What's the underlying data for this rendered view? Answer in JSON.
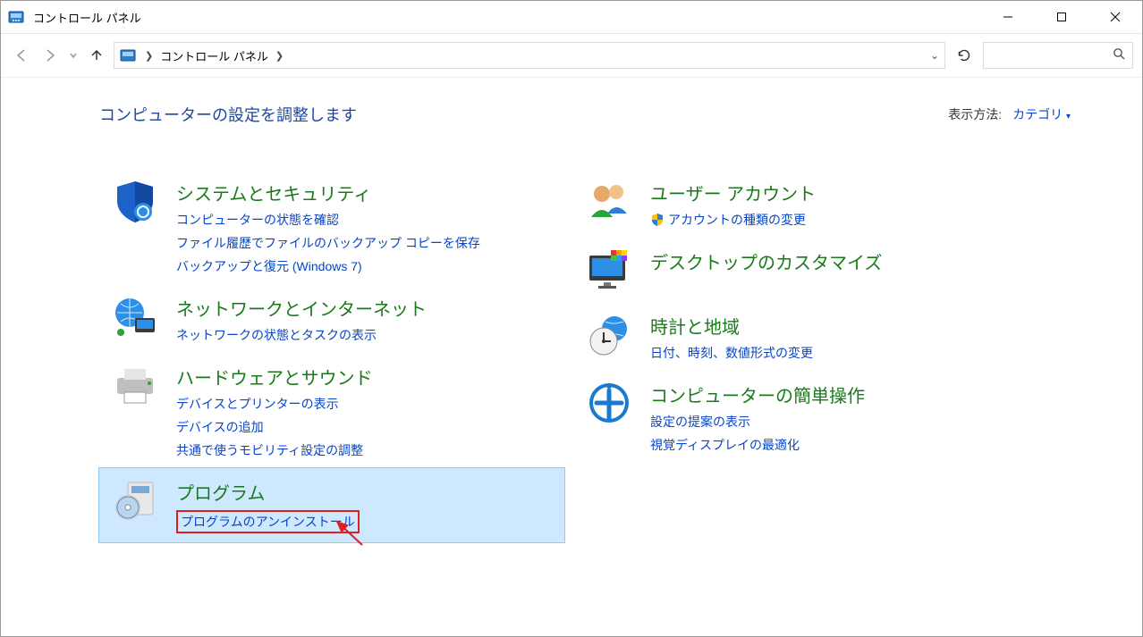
{
  "titlebar": {
    "title": "コントロール パネル"
  },
  "nav": {
    "breadcrumb": "コントロール パネル"
  },
  "page": {
    "title": "コンピューターの設定を調整します",
    "view_label": "表示方法:",
    "view_value": "カテゴリ"
  },
  "categories": {
    "left": [
      {
        "id": "system-security",
        "head": "システムとセキュリティ",
        "subs": [
          {
            "id": "system-status",
            "text": "コンピューターの状態を確認"
          },
          {
            "id": "file-history",
            "text": "ファイル履歴でファイルのバックアップ コピーを保存"
          },
          {
            "id": "backup-restore",
            "text": "バックアップと復元 (Windows 7)"
          }
        ]
      },
      {
        "id": "network",
        "head": "ネットワークとインターネット",
        "subs": [
          {
            "id": "net-status",
            "text": "ネットワークの状態とタスクの表示"
          }
        ]
      },
      {
        "id": "hardware-sound",
        "head": "ハードウェアとサウンド",
        "subs": [
          {
            "id": "devices-printers",
            "text": "デバイスとプリンターの表示"
          },
          {
            "id": "add-device",
            "text": "デバイスの追加"
          },
          {
            "id": "mobility",
            "text": "共通で使うモビリティ設定の調整"
          }
        ]
      },
      {
        "id": "programs",
        "head": "プログラム",
        "highlight": true,
        "subs": [
          {
            "id": "uninstall",
            "text": "プログラムのアンインストール",
            "boxed": true
          }
        ]
      }
    ],
    "right": [
      {
        "id": "user-accounts",
        "head": "ユーザー アカウント",
        "subs": [
          {
            "id": "change-account-type",
            "text": "アカウントの種類の変更",
            "shield": true
          }
        ]
      },
      {
        "id": "appearance",
        "head": "デスクトップのカスタマイズ",
        "subs": []
      },
      {
        "id": "clock-region",
        "head": "時計と地域",
        "subs": [
          {
            "id": "date-time-format",
            "text": "日付、時刻、数値形式の変更"
          }
        ]
      },
      {
        "id": "ease-of-access",
        "head": "コンピューターの簡単操作",
        "subs": [
          {
            "id": "ease-suggest",
            "text": "設定の提案の表示"
          },
          {
            "id": "display-optimize",
            "text": "視覚ディスプレイの最適化"
          }
        ]
      }
    ]
  }
}
